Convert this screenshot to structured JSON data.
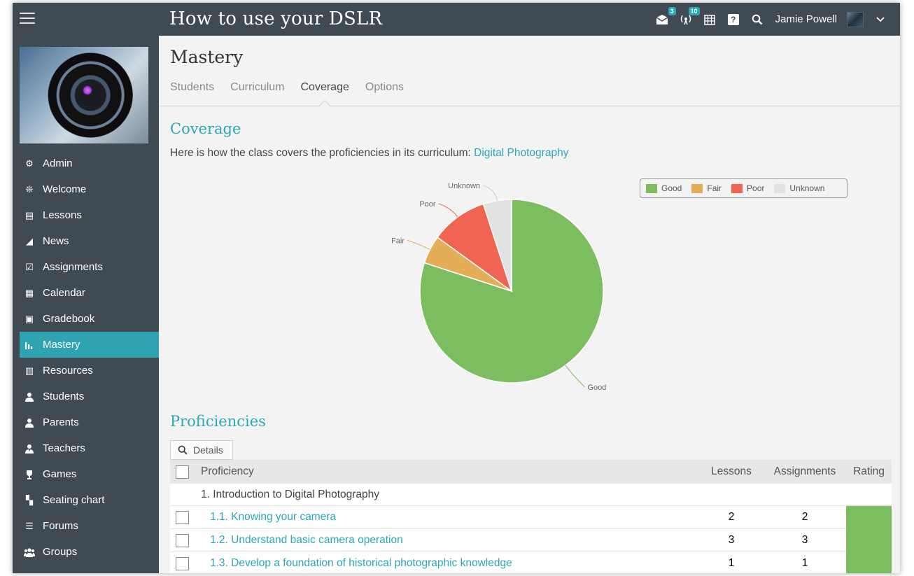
{
  "app": {
    "class_title": "How to use your DSLR"
  },
  "topbar": {
    "messages_badge": "3",
    "notifications_badge": "10",
    "user_name": "Jamie Powell"
  },
  "sidebar": {
    "items": [
      {
        "label": "Admin",
        "icon": "gear-icon"
      },
      {
        "label": "Welcome",
        "icon": "sparkle-icon"
      },
      {
        "label": "Lessons",
        "icon": "book-icon"
      },
      {
        "label": "News",
        "icon": "megaphone-icon"
      },
      {
        "label": "Assignments",
        "icon": "checkbox-icon"
      },
      {
        "label": "Calendar",
        "icon": "calendar-icon"
      },
      {
        "label": "Gradebook",
        "icon": "gradebook-icon"
      },
      {
        "label": "Mastery",
        "icon": "bar-chart-icon",
        "active": true
      },
      {
        "label": "Resources",
        "icon": "library-icon"
      },
      {
        "label": "Students",
        "icon": "user-icon"
      },
      {
        "label": "Parents",
        "icon": "user-icon"
      },
      {
        "label": "Teachers",
        "icon": "teacher-icon"
      },
      {
        "label": "Games",
        "icon": "trophy-icon"
      },
      {
        "label": "Seating chart",
        "icon": "seating-icon"
      },
      {
        "label": "Forums",
        "icon": "list-icon"
      },
      {
        "label": "Groups",
        "icon": "group-icon"
      }
    ]
  },
  "page": {
    "title": "Mastery",
    "tabs": [
      {
        "label": "Students"
      },
      {
        "label": "Curriculum"
      },
      {
        "label": "Coverage",
        "active": true
      },
      {
        "label": "Options"
      }
    ]
  },
  "coverage": {
    "title": "Coverage",
    "description": "Here is how the class covers the proficiencies in its curriculum: ",
    "curriculum_link": "Digital Photography"
  },
  "chart_data": {
    "type": "pie",
    "categories": [
      "Good",
      "Fair",
      "Poor",
      "Unknown"
    ],
    "values": [
      80,
      5,
      10,
      5
    ],
    "colors": [
      "#7cbd5f",
      "#e4ad58",
      "#f06452",
      "#e2e2e2"
    ],
    "legend_position": "top-right"
  },
  "proficiencies": {
    "title": "Proficiencies",
    "details_label": "Details",
    "columns": {
      "proficiency": "Proficiency",
      "lessons": "Lessons",
      "assignments": "Assignments",
      "rating": "Rating"
    },
    "group": "1. Introduction to Digital Photography",
    "rows": [
      {
        "name": "1.1. Knowing your camera",
        "lessons": "2",
        "assignments": "2",
        "rating": "Good"
      },
      {
        "name": "1.2. Understand basic camera operation",
        "lessons": "3",
        "assignments": "3",
        "rating": "Good"
      },
      {
        "name": "1.3. Develop a foundation of historical photographic knowledge",
        "lessons": "1",
        "assignments": "1",
        "rating": "Good"
      }
    ]
  }
}
